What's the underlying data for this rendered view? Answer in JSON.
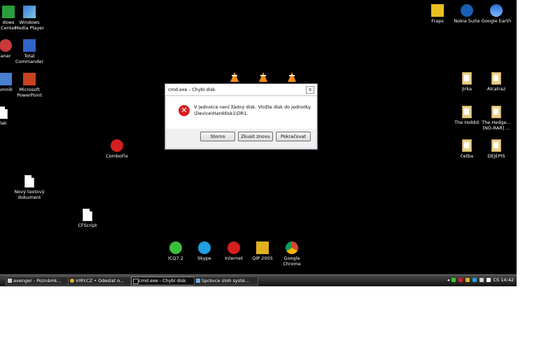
{
  "desktop": {
    "icons_left": [
      {
        "label": "dows\nCenter",
        "icon": "windows-media-center-icon"
      },
      {
        "label": "Windows\nMedia Player",
        "icon": "windows-media-player-icon"
      },
      {
        "label": "aner",
        "icon": "scanner-icon"
      },
      {
        "label": "Total\nCommander",
        "icon": "total-commander-icon"
      },
      {
        "label": "umník",
        "icon": "computer-icon"
      },
      {
        "label": "Microsoft\nPowerPoint",
        "icon": "powerpoint-icon"
      },
      {
        "label": "ílak",
        "icon": "file-icon"
      },
      {
        "label": "ComboFix",
        "icon": "combofix-icon"
      },
      {
        "label": "Nový textový\ndokument",
        "icon": "text-file-icon"
      },
      {
        "label": "CFScript",
        "icon": "script-file-icon"
      }
    ],
    "icons_right": [
      {
        "label": "Fraps",
        "icon": "fraps-icon"
      },
      {
        "label": "Nokia Suite",
        "icon": "nokia-suite-icon"
      },
      {
        "label": "Google Earth",
        "icon": "google-earth-icon"
      },
      {
        "label": "Jirka",
        "icon": "folder-icon"
      },
      {
        "label": "Alcatraz",
        "icon": "folder-icon"
      },
      {
        "label": "The Hobbit",
        "icon": "folder-icon"
      },
      {
        "label": "The.Hedge...\n[NO-RAR] ...",
        "icon": "folder-icon"
      },
      {
        "label": "četba",
        "icon": "folder-icon"
      },
      {
        "label": "DEJEPIS",
        "icon": "folder-icon"
      }
    ],
    "icons_bottom": [
      {
        "label": "ICQ7.2",
        "icon": "icq-icon"
      },
      {
        "label": "Skype",
        "icon": "skype-icon"
      },
      {
        "label": "Internet",
        "icon": "opera-icon"
      },
      {
        "label": "QIP 2005",
        "icon": "qip-icon"
      },
      {
        "label": "Google\nChrome",
        "icon": "chrome-icon"
      }
    ]
  },
  "dialog": {
    "title": "cmd.exe - Chybí disk",
    "close_label": "x",
    "message_line1": "V jednotce není žádný disk. Vložte disk do jednotky",
    "message_line2": "\\Device\\Harddisk1\\DR1.",
    "buttons": [
      "Storno",
      "Zkusit znovu",
      "Pokračovat"
    ]
  },
  "taskbar": {
    "tasks": [
      {
        "label": "avenger - Poznámk..."
      },
      {
        "label": "VIRY.CZ • Odeslat o..."
      },
      {
        "label": "cmd.exe - Chybí disk"
      },
      {
        "label": "Správce úloh systé..."
      }
    ],
    "clock": "14:42",
    "language": "CS"
  },
  "colors": {
    "desktop_bg": "#000000",
    "error_red": "#d42020",
    "folder": "#e9d08a",
    "vlc_orange": "#f28c16"
  }
}
